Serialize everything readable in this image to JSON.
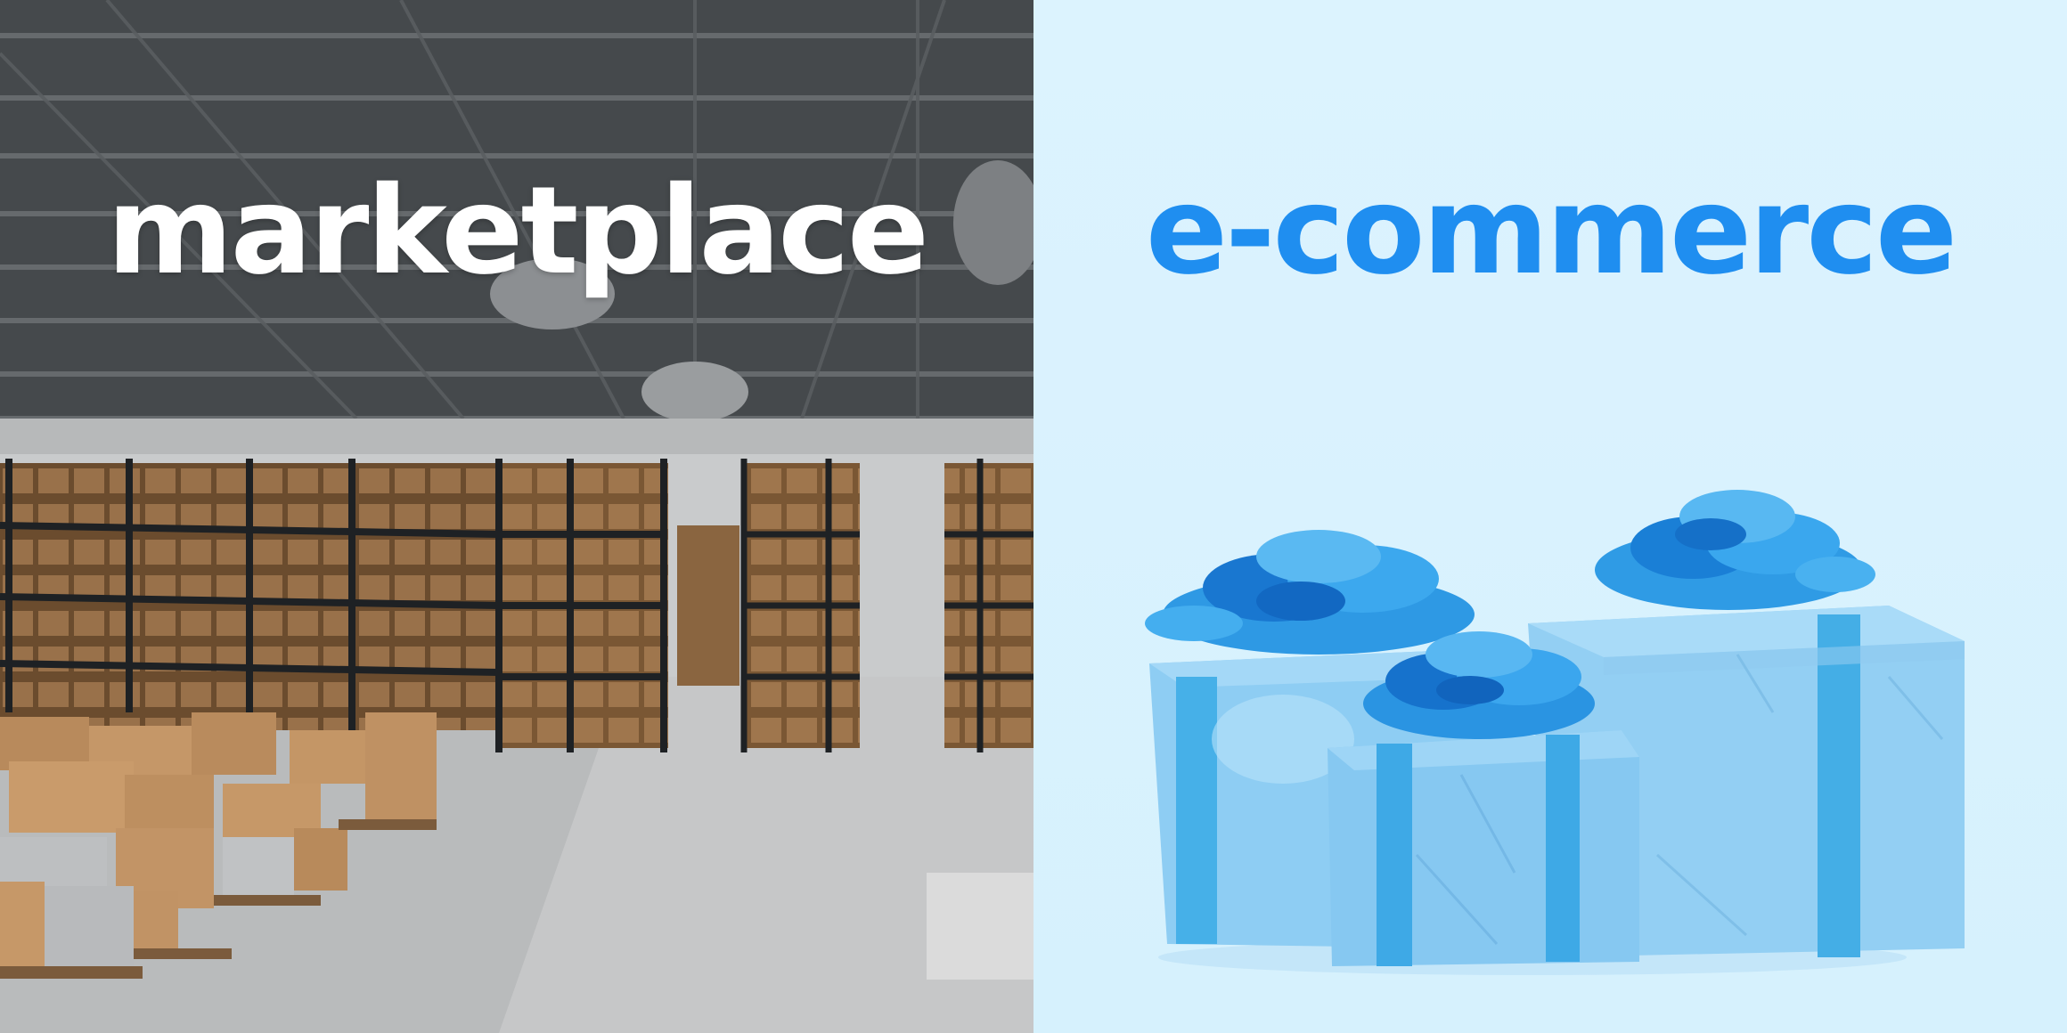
{
  "left_panel": {
    "headline": "marketplace",
    "scene": "warehouse-photo",
    "text_color": "#ffffff"
  },
  "right_panel": {
    "headline": "e-commerce",
    "scene": "gift-boxes-photo",
    "text_color": "#1f8ef0",
    "background_color": "#dcf3fe"
  }
}
